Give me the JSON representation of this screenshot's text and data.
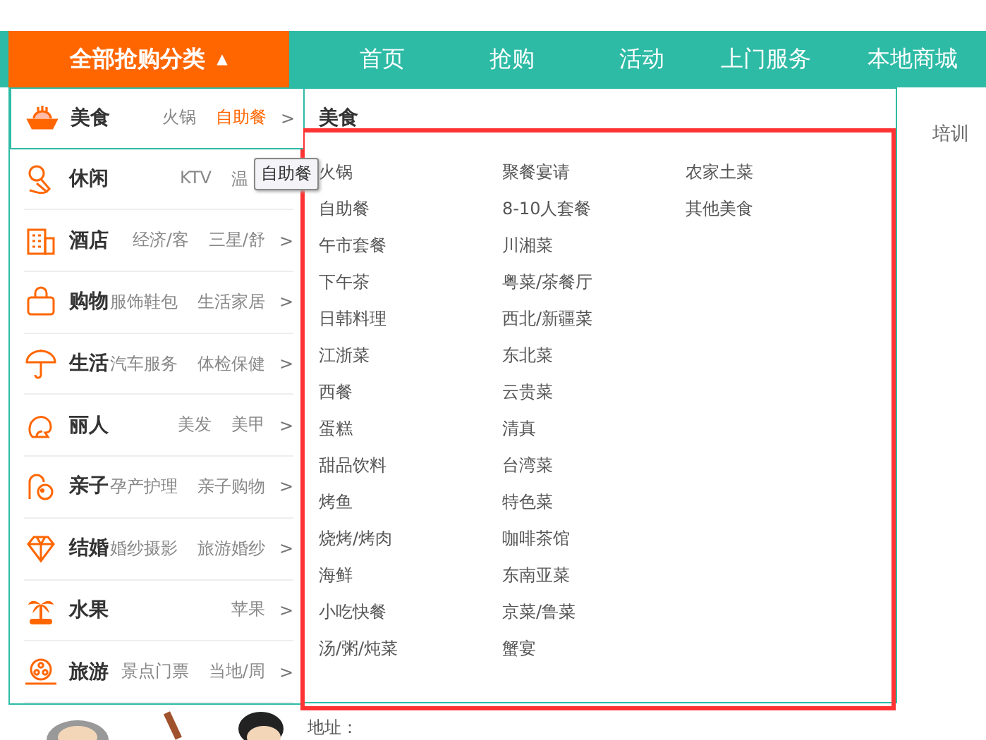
{
  "category_button": {
    "label": "全部抢购分类",
    "arrow": "▲"
  },
  "nav": [
    {
      "label": "首页"
    },
    {
      "label": "抢购"
    },
    {
      "label": "活动"
    },
    {
      "label": "上门服务"
    },
    {
      "label": "本地商城"
    }
  ],
  "categories": [
    {
      "kind": "food",
      "name": "美食",
      "selected": true,
      "links": [
        {
          "text": "火锅",
          "highlighted": false
        },
        {
          "text": "自助餐",
          "highlighted": true
        }
      ],
      "arrow": ">"
    },
    {
      "kind": "leisure",
      "name": "休闲",
      "selected": false,
      "links": [
        {
          "text": "KTV",
          "highlighted": false
        },
        {
          "text": "温",
          "highlighted": false
        }
      ]
    },
    {
      "kind": "hotel",
      "name": "酒店",
      "selected": false,
      "links": [
        {
          "text": "经济/客",
          "highlighted": false
        },
        {
          "text": "三星/舒",
          "highlighted": false
        }
      ],
      "arrow": ">"
    },
    {
      "kind": "shopping",
      "name": "购物",
      "selected": false,
      "links": [
        {
          "text": "服饰鞋包",
          "highlighted": false
        },
        {
          "text": "生活家居",
          "highlighted": false
        }
      ],
      "arrow": ">"
    },
    {
      "kind": "life",
      "name": "生活",
      "selected": false,
      "links": [
        {
          "text": "汽车服务",
          "highlighted": false
        },
        {
          "text": "体检保健",
          "highlighted": false
        }
      ],
      "arrow": ">"
    },
    {
      "kind": "beauty",
      "name": "丽人",
      "selected": false,
      "links": [
        {
          "text": "美发",
          "highlighted": false
        },
        {
          "text": "美甲",
          "highlighted": false
        }
      ],
      "arrow": ">"
    },
    {
      "kind": "kids",
      "name": "亲子",
      "selected": false,
      "links": [
        {
          "text": "孕产护理",
          "highlighted": false
        },
        {
          "text": "亲子购物",
          "highlighted": false
        }
      ],
      "arrow": ">"
    },
    {
      "kind": "wedding",
      "name": "结婚",
      "selected": false,
      "links": [
        {
          "text": "婚纱摄影",
          "highlighted": false
        },
        {
          "text": "旅游婚纱",
          "highlighted": false
        }
      ],
      "arrow": ">"
    },
    {
      "kind": "fruit",
      "name": "水果",
      "selected": false,
      "links": [
        {
          "text": "苹果",
          "highlighted": false
        }
      ],
      "arrow": ">"
    },
    {
      "kind": "travel",
      "name": "旅游",
      "selected": false,
      "links": [
        {
          "text": "景点门票",
          "highlighted": false
        },
        {
          "text": "当地/周",
          "highlighted": false
        }
      ],
      "arrow": ">"
    }
  ],
  "tooltip": "自助餐",
  "panel": {
    "title": "美食",
    "columns": [
      [
        "火锅",
        "自助餐",
        "午市套餐",
        "下午茶",
        "日韩料理",
        "江浙菜",
        "西餐",
        "蛋糕",
        "甜品饮料",
        "烤鱼",
        "烧烤/烤肉",
        "海鲜",
        "小吃快餐",
        "汤/粥/炖菜"
      ],
      [
        "聚餐宴请",
        "8-10人套餐",
        "川湘菜",
        "粤菜/茶餐厅",
        "西北/新疆菜",
        "东北菜",
        "云贵菜",
        "清真",
        "台湾菜",
        "特色菜",
        "咖啡茶馆",
        "东南亚菜",
        "京菜/鲁菜",
        "蟹宴"
      ],
      [
        "农家土菜",
        "其他美食"
      ]
    ]
  },
  "background": {
    "side_text": "培训",
    "address_label": "地址："
  }
}
